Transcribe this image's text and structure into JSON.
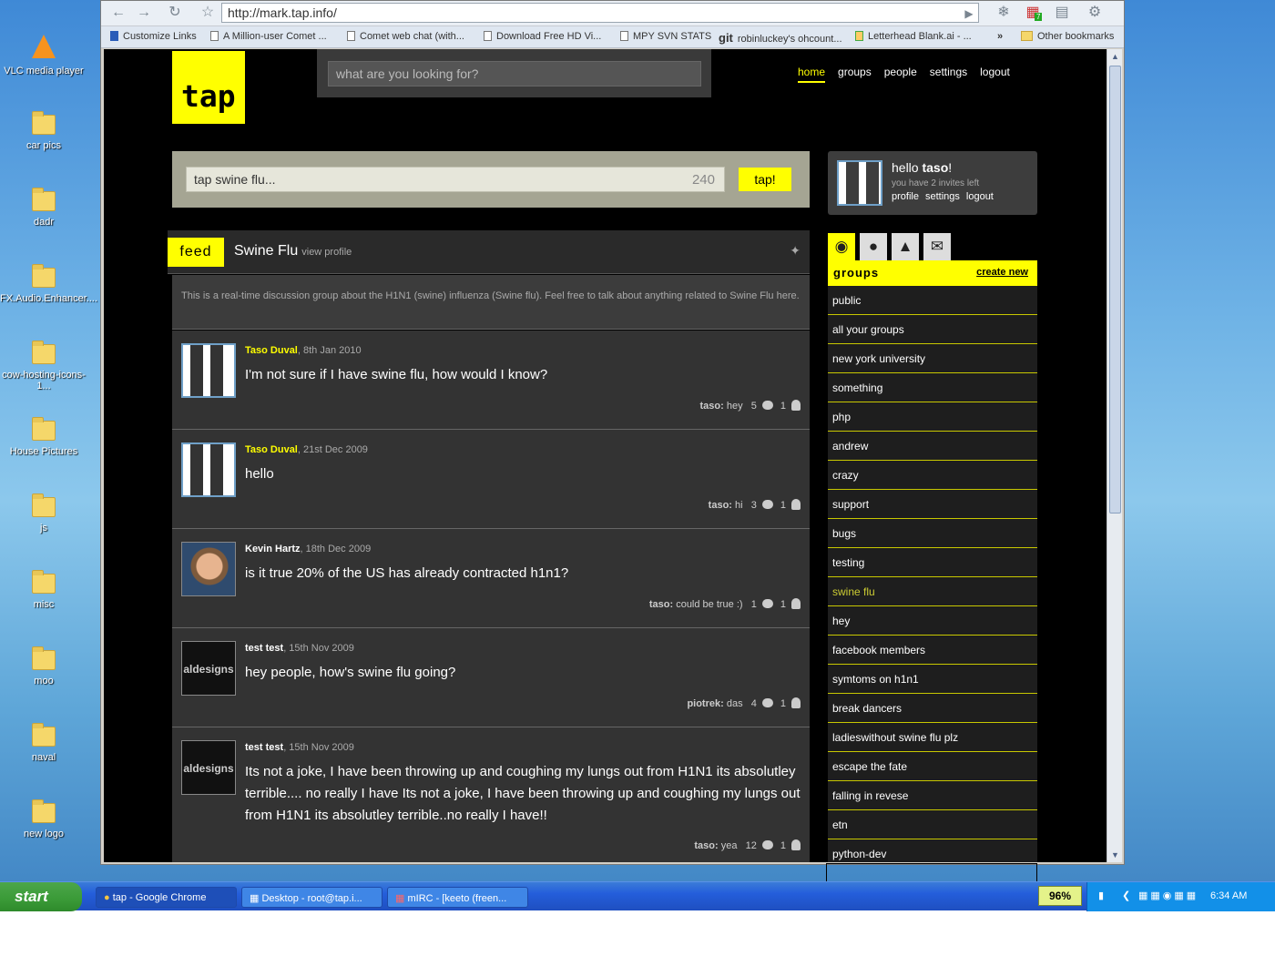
{
  "desktop": {
    "icons": [
      "VLC media player",
      "car pics",
      "dadr",
      "FX.Audio.Enhancer....",
      "cow-hosting-icons-1...",
      "House Pictures",
      "js",
      "misc",
      "moo",
      "naval",
      "new logo"
    ]
  },
  "browser": {
    "url": "http://mark.tap.info/",
    "bookmarks": [
      "Customize Links",
      "A Million-user Comet ...",
      "Comet web chat (with...",
      "Download Free HD Vi...",
      "MPY SVN STATS",
      "robinluckey's ohcount...",
      "Letterhead Blank.ai - ...",
      "»",
      "Other bookmarks"
    ],
    "git_label": "git",
    "badge": "7"
  },
  "site": {
    "logo": "tap",
    "search_placeholder": "what are you looking for?",
    "nav": [
      "home",
      "groups",
      "people",
      "settings",
      "logout"
    ],
    "post_placeholder": "tap swine flu...",
    "char_count": "240",
    "post_button": "tap!",
    "feed_tag": "feed",
    "feed_title": "Swine Flu",
    "view_profile": "view profile",
    "description": "This is a real-time discussion group about the H1N1 (swine) influenza (Swine flu). Feel free to talk about anything related to Swine Flu here."
  },
  "posts": [
    {
      "author": "Taso Duval",
      "date": ", 8th Jan 2010",
      "text": "I'm not sure if I have swine flu, how would I know?",
      "last_user": "taso:",
      "last_text": " hey",
      "comments": "5",
      "people": "1"
    },
    {
      "author": "Taso Duval",
      "date": ", 21st Dec 2009",
      "text": "hello",
      "last_user": "taso:",
      "last_text": " hi",
      "comments": "3",
      "people": "1"
    },
    {
      "author": "Kevin Hartz",
      "date": ", 18th Dec 2009",
      "text": "is it true 20% of the US has already contracted h1n1?",
      "last_user": "taso:",
      "last_text": " could be true :)",
      "comments": "1",
      "people": "1"
    },
    {
      "author": "test test",
      "date": ", 15th Nov 2009",
      "text": "hey people, how's swine flu going?",
      "last_user": "piotrek:",
      "last_text": " das",
      "comments": "4",
      "people": "1"
    },
    {
      "author": "test test",
      "date": ", 15th Nov 2009",
      "text": "Its not a joke, I have been throwing up and coughing my lungs out from H1N1 its absolutley terrible.... no really I have Its not a joke, I have been throwing up and coughing my lungs out from H1N1 its absolutley terrible..no really I have!!",
      "last_user": "taso:",
      "last_text": " yea",
      "comments": "12",
      "people": "1"
    }
  ],
  "avatar_logo_text": "aldesigns",
  "user_box": {
    "greeting": "hello ",
    "name": "taso",
    "bang": "!",
    "invites": "you have 2 invites left",
    "links": [
      "profile",
      "settings",
      "logout"
    ]
  },
  "groups": {
    "title": "groups",
    "create": "create new",
    "items": [
      "public",
      "all your groups",
      "new york university",
      "something",
      "php",
      "andrew",
      "crazy",
      "support",
      "bugs",
      "testing",
      "swine flu",
      "hey",
      "facebook members",
      "symtoms on h1n1",
      "break dancers",
      "ladieswithout swine flu plz",
      "escape the fate",
      "falling in revese",
      "etn",
      "python-dev"
    ],
    "selected": "swine flu"
  },
  "taskbar": {
    "start": "start",
    "windows": [
      "tap - Google Chrome",
      "Desktop - root@tap.i...",
      "mIRC - [keeto (freen..."
    ],
    "battery": "96%",
    "clock": "6:34 AM"
  },
  "colors": {
    "accent": "#ffff00",
    "page_bg": "#000000",
    "panel": "#333333"
  }
}
